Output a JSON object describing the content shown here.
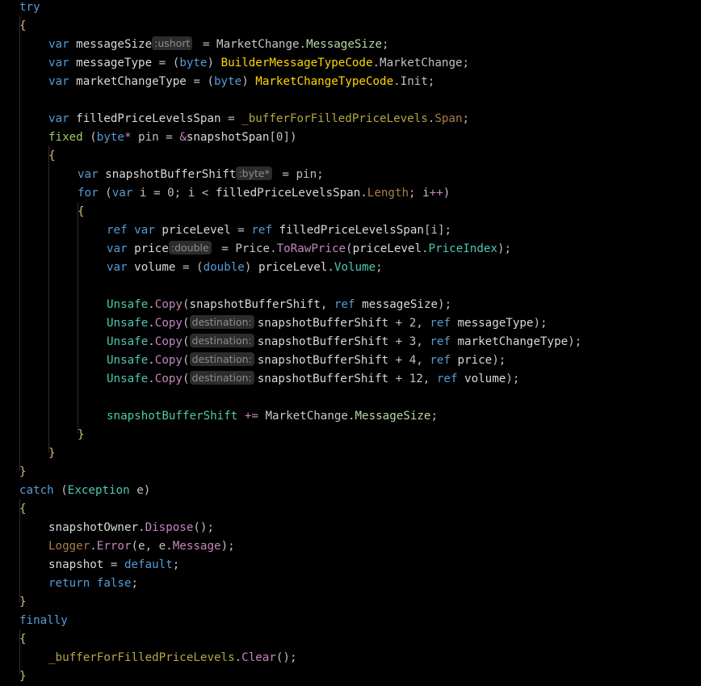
{
  "editor": {
    "theme_background": "#000000",
    "lines": [
      {
        "indent": 0,
        "tokens": [
          {
            "t": "try",
            "c": "#569cd6"
          }
        ]
      },
      {
        "indent": 0,
        "tokens": [
          {
            "t": "{",
            "c": "#d7ba7d"
          }
        ]
      },
      {
        "indent": 1,
        "tokens": [
          {
            "t": "var ",
            "c": "#569cd6"
          },
          {
            "t": "messageSize",
            "c": "#d9d9d9"
          },
          {
            "hint": ":ushort"
          },
          {
            "t": " = ",
            "c": "#c0c0c0"
          },
          {
            "t": "MarketChange",
            "c": "#c8c8c8"
          },
          {
            "t": ".",
            "c": "#c0c0c0"
          },
          {
            "t": "MessageSize",
            "c": "#b8d7a3"
          },
          {
            "t": ";",
            "c": "#c0c0c0"
          }
        ]
      },
      {
        "indent": 1,
        "tokens": [
          {
            "t": "var ",
            "c": "#569cd6"
          },
          {
            "t": "messageType",
            "c": "#d9d9d9"
          },
          {
            "t": " = (",
            "c": "#c0c0c0"
          },
          {
            "t": "byte",
            "c": "#569cd6"
          },
          {
            "t": ") ",
            "c": "#c0c0c0"
          },
          {
            "t": "BuilderMessageTypeCode",
            "c": "#ffd700"
          },
          {
            "t": ".",
            "c": "#c0c0c0"
          },
          {
            "t": "MarketChange",
            "c": "#c0c0c0"
          },
          {
            "t": ";",
            "c": "#c0c0c0"
          }
        ]
      },
      {
        "indent": 1,
        "tokens": [
          {
            "t": "var ",
            "c": "#569cd6"
          },
          {
            "t": "marketChangeType",
            "c": "#d9d9d9"
          },
          {
            "t": " = (",
            "c": "#c0c0c0"
          },
          {
            "t": "byte",
            "c": "#569cd6"
          },
          {
            "t": ") ",
            "c": "#c0c0c0"
          },
          {
            "t": "MarketChangeTypeCode",
            "c": "#ffd700"
          },
          {
            "t": ".",
            "c": "#c0c0c0"
          },
          {
            "t": "Init",
            "c": "#c0c0c0"
          },
          {
            "t": ";",
            "c": "#c0c0c0"
          }
        ]
      },
      {
        "indent": 0,
        "tokens": []
      },
      {
        "indent": 1,
        "tokens": [
          {
            "t": "var ",
            "c": "#569cd6"
          },
          {
            "t": "filledPriceLevelsSpan",
            "c": "#d9d9d9"
          },
          {
            "t": " = ",
            "c": "#c0c0c0"
          },
          {
            "t": "_bufferForFilledPriceLevels",
            "c": "#b5a642"
          },
          {
            "t": ".",
            "c": "#c0c0c0"
          },
          {
            "t": "Span",
            "c": "#a97d4b"
          },
          {
            "t": ";",
            "c": "#c0c0c0"
          }
        ]
      },
      {
        "indent": 1,
        "tokens": [
          {
            "t": "fixed ",
            "c": "#9ccc65"
          },
          {
            "t": "(",
            "c": "#c0c0c0"
          },
          {
            "t": "byte",
            "c": "#569cd6"
          },
          {
            "t": "*",
            "c": "#c586c0"
          },
          {
            "t": " pin = ",
            "c": "#c0c0c0"
          },
          {
            "t": "&",
            "c": "#c586c0"
          },
          {
            "t": "snapshotSpan",
            "c": "#d9d9d9"
          },
          {
            "t": "[",
            "c": "#c0c0c0"
          },
          {
            "t": "0",
            "c": "#c0c0c0"
          },
          {
            "t": "])",
            "c": "#c0c0c0"
          }
        ]
      },
      {
        "indent": 1,
        "tokens": [
          {
            "t": "{",
            "c": "#d7ba7d"
          }
        ]
      },
      {
        "indent": 2,
        "tokens": [
          {
            "t": "var ",
            "c": "#569cd6"
          },
          {
            "t": "snapshotBufferShift",
            "c": "#d9d9d9"
          },
          {
            "hint": ":byte*"
          },
          {
            "t": " = pin;",
            "c": "#c0c0c0"
          }
        ]
      },
      {
        "indent": 2,
        "tokens": [
          {
            "t": "for ",
            "c": "#569cd6"
          },
          {
            "t": "(",
            "c": "#c0c0c0"
          },
          {
            "t": "var ",
            "c": "#569cd6"
          },
          {
            "t": "i = ",
            "c": "#c0c0c0"
          },
          {
            "t": "0",
            "c": "#c0c0c0"
          },
          {
            "t": "; i < ",
            "c": "#c0c0c0"
          },
          {
            "t": "filledPriceLevelsSpan",
            "c": "#d9d9d9"
          },
          {
            "t": ".",
            "c": "#c0c0c0"
          },
          {
            "t": "Length",
            "c": "#a97d4b"
          },
          {
            "t": "; i",
            "c": "#c0c0c0"
          },
          {
            "t": "++",
            "c": "#c586c0"
          },
          {
            "t": ")",
            "c": "#c0c0c0"
          }
        ]
      },
      {
        "indent": 2,
        "tokens": [
          {
            "t": "{",
            "c": "#d7ba7d"
          }
        ]
      },
      {
        "indent": 3,
        "tokens": [
          {
            "t": "ref ",
            "c": "#569cd6"
          },
          {
            "t": "var ",
            "c": "#569cd6"
          },
          {
            "t": "priceLevel",
            "c": "#d9d9d9"
          },
          {
            "t": " = ",
            "c": "#c0c0c0"
          },
          {
            "t": "ref ",
            "c": "#569cd6"
          },
          {
            "t": "filledPriceLevelsSpan",
            "c": "#d9d9d9"
          },
          {
            "t": "[i];",
            "c": "#c0c0c0"
          }
        ]
      },
      {
        "indent": 3,
        "tokens": [
          {
            "t": "var ",
            "c": "#569cd6"
          },
          {
            "t": "price",
            "c": "#d9d9d9"
          },
          {
            "hint": ":double"
          },
          {
            "t": " = ",
            "c": "#c0c0c0"
          },
          {
            "t": "Price",
            "c": "#c8c8c8"
          },
          {
            "t": ".",
            "c": "#c0c0c0"
          },
          {
            "t": "ToRawPrice",
            "c": "#c586c0"
          },
          {
            "t": "(",
            "c": "#c0c0c0"
          },
          {
            "t": "priceLevel",
            "c": "#d9d9d9"
          },
          {
            "t": ".",
            "c": "#c0c0c0"
          },
          {
            "t": "PriceIndex",
            "c": "#4ec9b0"
          },
          {
            "t": ");",
            "c": "#c0c0c0"
          }
        ]
      },
      {
        "indent": 3,
        "tokens": [
          {
            "t": "var ",
            "c": "#569cd6"
          },
          {
            "t": "volume",
            "c": "#d9d9d9"
          },
          {
            "t": " = (",
            "c": "#c0c0c0"
          },
          {
            "t": "double",
            "c": "#569cd6"
          },
          {
            "t": ") ",
            "c": "#c0c0c0"
          },
          {
            "t": "priceLevel",
            "c": "#d9d9d9"
          },
          {
            "t": ".",
            "c": "#c0c0c0"
          },
          {
            "t": "Volume",
            "c": "#4ec9b0"
          },
          {
            "t": ";",
            "c": "#c0c0c0"
          }
        ]
      },
      {
        "indent": 0,
        "tokens": []
      },
      {
        "indent": 3,
        "tokens": [
          {
            "t": "Unsafe",
            "c": "#4ec9b0"
          },
          {
            "t": ".",
            "c": "#c0c0c0"
          },
          {
            "t": "Copy",
            "c": "#c586c0"
          },
          {
            "t": "(",
            "c": "#c0c0c0"
          },
          {
            "t": "snapshotBufferShift",
            "c": "#d9d9d9"
          },
          {
            "t": ", ",
            "c": "#c0c0c0"
          },
          {
            "t": "ref ",
            "c": "#569cd6"
          },
          {
            "t": "messageSize",
            "c": "#d9d9d9"
          },
          {
            "t": ");",
            "c": "#c0c0c0"
          }
        ]
      },
      {
        "indent": 3,
        "tokens": [
          {
            "t": "Unsafe",
            "c": "#4ec9b0"
          },
          {
            "t": ".",
            "c": "#c0c0c0"
          },
          {
            "t": "Copy",
            "c": "#c586c0"
          },
          {
            "t": "(",
            "c": "#c0c0c0"
          },
          {
            "hint": "destination:"
          },
          {
            "t": "snapshotBufferShift",
            "c": "#d9d9d9"
          },
          {
            "t": " + ",
            "c": "#c0c0c0"
          },
          {
            "t": "2",
            "c": "#c0c0c0"
          },
          {
            "t": ", ",
            "c": "#c0c0c0"
          },
          {
            "t": "ref ",
            "c": "#569cd6"
          },
          {
            "t": "messageType",
            "c": "#d9d9d9"
          },
          {
            "t": ");",
            "c": "#c0c0c0"
          }
        ]
      },
      {
        "indent": 3,
        "tokens": [
          {
            "t": "Unsafe",
            "c": "#4ec9b0"
          },
          {
            "t": ".",
            "c": "#c0c0c0"
          },
          {
            "t": "Copy",
            "c": "#c586c0"
          },
          {
            "t": "(",
            "c": "#c0c0c0"
          },
          {
            "hint": "destination:"
          },
          {
            "t": "snapshotBufferShift",
            "c": "#d9d9d9"
          },
          {
            "t": " + ",
            "c": "#c0c0c0"
          },
          {
            "t": "3",
            "c": "#c0c0c0"
          },
          {
            "t": ", ",
            "c": "#c0c0c0"
          },
          {
            "t": "ref ",
            "c": "#569cd6"
          },
          {
            "t": "marketChangeType",
            "c": "#d9d9d9"
          },
          {
            "t": ");",
            "c": "#c0c0c0"
          }
        ]
      },
      {
        "indent": 3,
        "tokens": [
          {
            "t": "Unsafe",
            "c": "#4ec9b0"
          },
          {
            "t": ".",
            "c": "#c0c0c0"
          },
          {
            "t": "Copy",
            "c": "#c586c0"
          },
          {
            "t": "(",
            "c": "#c0c0c0"
          },
          {
            "hint": "destination:"
          },
          {
            "t": "snapshotBufferShift",
            "c": "#d9d9d9"
          },
          {
            "t": " + ",
            "c": "#c0c0c0"
          },
          {
            "t": "4",
            "c": "#c0c0c0"
          },
          {
            "t": ", ",
            "c": "#c0c0c0"
          },
          {
            "t": "ref ",
            "c": "#569cd6"
          },
          {
            "t": "price",
            "c": "#d9d9d9"
          },
          {
            "t": ");",
            "c": "#c0c0c0"
          }
        ]
      },
      {
        "indent": 3,
        "tokens": [
          {
            "t": "Unsafe",
            "c": "#4ec9b0"
          },
          {
            "t": ".",
            "c": "#c0c0c0"
          },
          {
            "t": "Copy",
            "c": "#c586c0"
          },
          {
            "t": "(",
            "c": "#c0c0c0"
          },
          {
            "hint": "destination:"
          },
          {
            "t": "snapshotBufferShift",
            "c": "#d9d9d9"
          },
          {
            "t": " + ",
            "c": "#c0c0c0"
          },
          {
            "t": "12",
            "c": "#c0c0c0"
          },
          {
            "t": ", ",
            "c": "#c0c0c0"
          },
          {
            "t": "ref ",
            "c": "#569cd6"
          },
          {
            "t": "volume",
            "c": "#d9d9d9"
          },
          {
            "t": ");",
            "c": "#c0c0c0"
          }
        ]
      },
      {
        "indent": 0,
        "tokens": []
      },
      {
        "indent": 3,
        "tokens": [
          {
            "t": "snapshotBufferShift",
            "c": "#4ec9b0"
          },
          {
            "t": " += ",
            "c": "#c586c0"
          },
          {
            "t": "MarketChange",
            "c": "#c8c8c8"
          },
          {
            "t": ".",
            "c": "#c0c0c0"
          },
          {
            "t": "MessageSize",
            "c": "#b8d7a3"
          },
          {
            "t": ";",
            "c": "#c0c0c0"
          }
        ]
      },
      {
        "indent": 2,
        "tokens": [
          {
            "t": "}",
            "c": "#d7ba7d"
          }
        ]
      },
      {
        "indent": 1,
        "tokens": [
          {
            "t": "}",
            "c": "#d7ba7d"
          }
        ]
      },
      {
        "indent": 0,
        "tokens": [
          {
            "t": "}",
            "c": "#d7ba7d"
          }
        ]
      },
      {
        "indent": 0,
        "tokens": [
          {
            "t": "catch ",
            "c": "#569cd6"
          },
          {
            "t": "(",
            "c": "#c0c0c0"
          },
          {
            "t": "Exception",
            "c": "#4ec9b0"
          },
          {
            "t": " e)",
            "c": "#c0c0c0"
          }
        ]
      },
      {
        "indent": 0,
        "tokens": [
          {
            "t": "{",
            "c": "#d7ba7d"
          }
        ]
      },
      {
        "indent": 1,
        "tokens": [
          {
            "t": "snapshotOwner",
            "c": "#d9d9d9"
          },
          {
            "t": ".",
            "c": "#c0c0c0"
          },
          {
            "t": "Dispose",
            "c": "#c586c0"
          },
          {
            "t": "();",
            "c": "#c0c0c0"
          }
        ]
      },
      {
        "indent": 1,
        "tokens": [
          {
            "t": "Logger",
            "c": "#a97d4b"
          },
          {
            "t": ".",
            "c": "#c0c0c0"
          },
          {
            "t": "Error",
            "c": "#c586c0"
          },
          {
            "t": "(e, e.",
            "c": "#c0c0c0"
          },
          {
            "t": "Message",
            "c": "#c586c0"
          },
          {
            "t": ");",
            "c": "#c0c0c0"
          }
        ]
      },
      {
        "indent": 1,
        "tokens": [
          {
            "t": "snapshot",
            "c": "#d9d9d9"
          },
          {
            "t": " = ",
            "c": "#c0c0c0"
          },
          {
            "t": "default",
            "c": "#569cd6"
          },
          {
            "t": ";",
            "c": "#c0c0c0"
          }
        ]
      },
      {
        "indent": 1,
        "tokens": [
          {
            "t": "return ",
            "c": "#569cd6"
          },
          {
            "t": "false",
            "c": "#569cd6"
          },
          {
            "t": ";",
            "c": "#c0c0c0"
          }
        ]
      },
      {
        "indent": 0,
        "tokens": [
          {
            "t": "}",
            "c": "#d7ba7d"
          }
        ]
      },
      {
        "indent": 0,
        "tokens": [
          {
            "t": "finally",
            "c": "#569cd6"
          }
        ]
      },
      {
        "indent": 0,
        "tokens": [
          {
            "t": "{",
            "c": "#d7ba7d"
          }
        ]
      },
      {
        "indent": 1,
        "tokens": [
          {
            "t": "_bufferForFilledPriceLevels",
            "c": "#b5a642"
          },
          {
            "t": ".",
            "c": "#c0c0c0"
          },
          {
            "t": "Clear",
            "c": "#c586c0"
          },
          {
            "t": "();",
            "c": "#c0c0c0"
          }
        ]
      },
      {
        "indent": 0,
        "tokens": [
          {
            "t": "}",
            "c": "#d7ba7d"
          }
        ]
      }
    ]
  }
}
